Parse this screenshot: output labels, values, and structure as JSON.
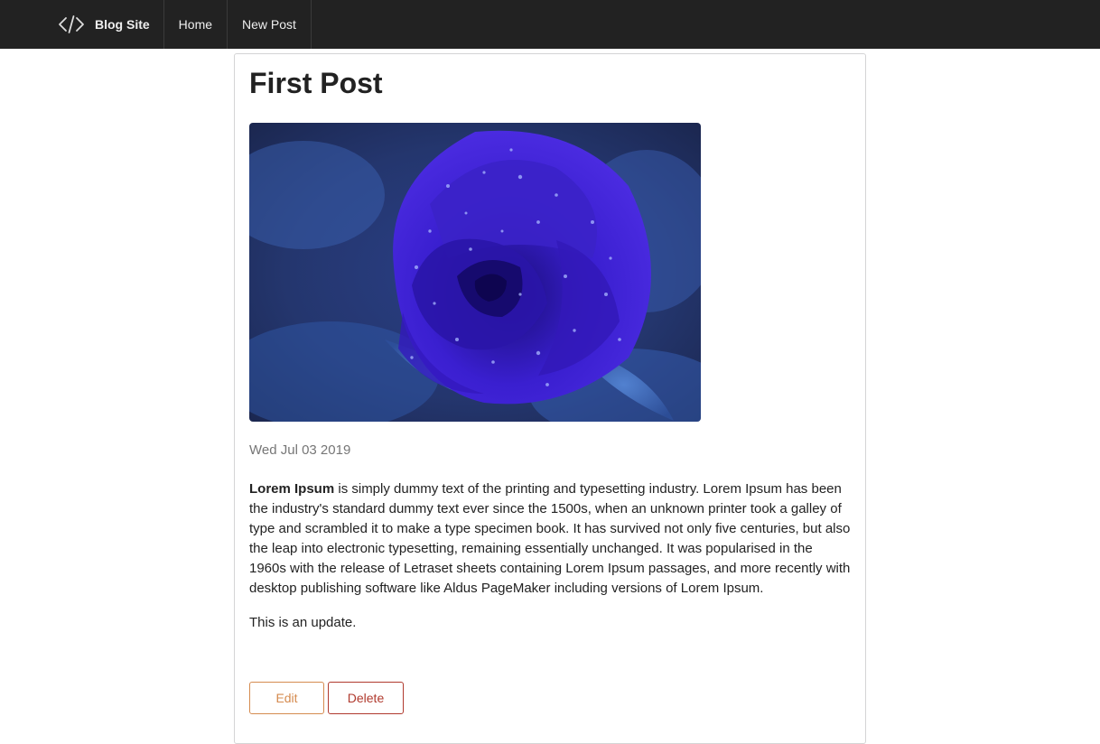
{
  "navbar": {
    "brand_icon": "code-icon",
    "brand_label": "Blog Site",
    "links": [
      {
        "label": "Home"
      },
      {
        "label": "New Post"
      }
    ],
    "background": "#222222"
  },
  "post": {
    "title": "First Post",
    "image_subject": "blue-rose-photo",
    "date": "Wed Jul 03 2019",
    "body_bold": "Lorem Ipsum",
    "body_rest": " is simply dummy text of the printing and typesetting industry. Lorem Ipsum has been the industry's standard dummy text ever since the 1500s, when an unknown printer took a galley of type and scrambled it to make a type specimen book. It has survived not only five centuries, but also the leap into electronic typesetting, remaining essentially unchanged. It was popularised in the 1960s with the release of Letraset sheets containing Lorem Ipsum passages, and more recently with desktop publishing software like Aldus PageMaker including versions of Lorem Ipsum.",
    "update_text": "This is an update."
  },
  "actions": {
    "edit_label": "Edit",
    "delete_label": "Delete",
    "edit_color": "#d58b4f",
    "delete_color": "#b03a2e"
  }
}
